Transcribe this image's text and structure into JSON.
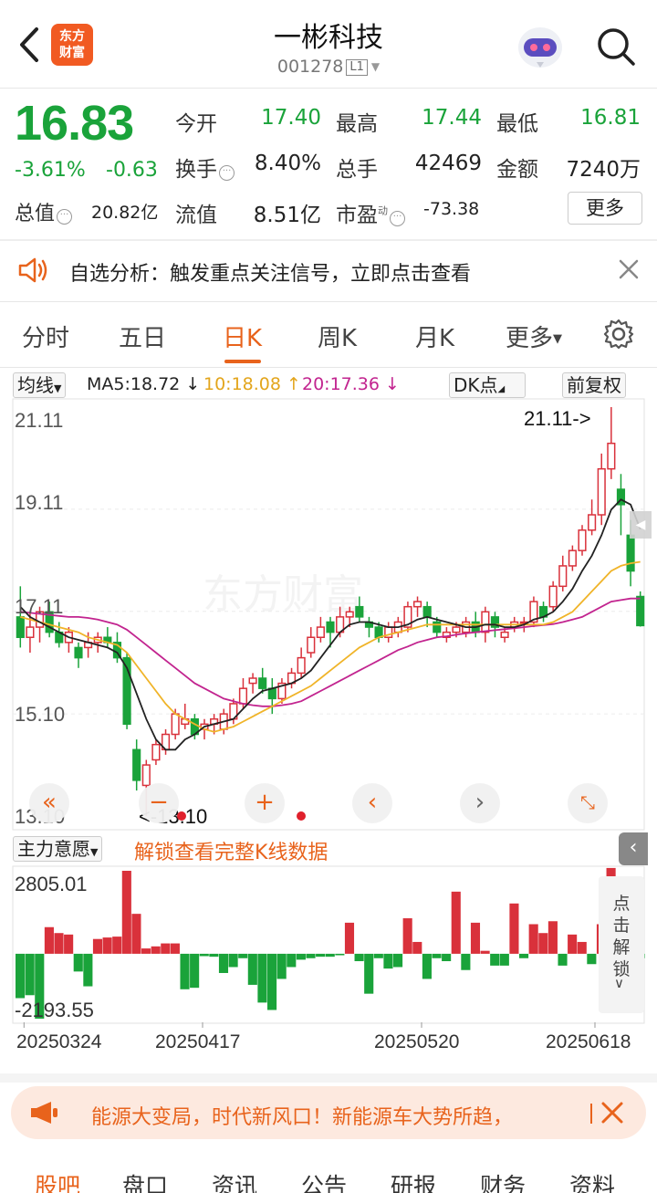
{
  "header": {
    "logo_line1": "东方",
    "logo_line2": "财富",
    "stock_name": "一彬科技",
    "stock_code": "001278",
    "market_tag": "L1"
  },
  "quote": {
    "price": "16.83",
    "change_pct": "-3.61%",
    "change": "-0.63",
    "open_label": "今开",
    "open": "17.40",
    "high_label": "最高",
    "high": "17.44",
    "low_label": "最低",
    "low": "16.81",
    "turnover_label": "换手",
    "turnover": "8.40%",
    "volume_label": "总手",
    "volume": "42469",
    "amount_label": "金额",
    "amount": "7240万",
    "total_value_label": "总值",
    "total_value": "20.82亿",
    "float_value_label": "流值",
    "float_value": "8.51亿",
    "pe_label": "市盈",
    "pe_sup": "动",
    "pe": "-73.38",
    "more_label": "更多"
  },
  "analysis_banner": {
    "text": "自选分析：触发重点关注信号，立即点击查看"
  },
  "tabs": [
    "分时",
    "五日",
    "日K",
    "周K",
    "月K",
    "更多"
  ],
  "active_tab": "日K",
  "chart_toolbar": {
    "ma_select": "均线",
    "ma5": "MA5:18.72 ↓",
    "ma10": "10:18.08 ↑",
    "ma20": "20:17.36 ↓",
    "dk_label": "DK点",
    "adjust_label": "前复权"
  },
  "colors": {
    "up": "#d9313b",
    "down": "#1aa33a",
    "ma5": "#222222",
    "ma10": "#f0b429",
    "ma20": "#c2248f",
    "accent": "#e8631c"
  },
  "price_axis": [
    "21.11",
    "19.11",
    "17.11",
    "15.10",
    "13.10"
  ],
  "annotations": {
    "max": "21.11->",
    "min": "<-13.10"
  },
  "indicator": {
    "select_label": "主力意愿",
    "unlock_text": "解锁查看完整K线数据",
    "max_label": "2805.01",
    "min_label": "-2193.55",
    "side_unlock": "点击解锁"
  },
  "dates": [
    "20250324",
    "20250417",
    "20250520",
    "20250618"
  ],
  "promo": {
    "text": "能源大变局，时代新风口！新能源车大势所趋，"
  },
  "bottom_nav": [
    "股吧",
    "盘口",
    "资讯",
    "公告",
    "研报",
    "财务",
    "资料"
  ],
  "chart_data": {
    "type": "candlestick",
    "y_range": [
      13.1,
      21.11
    ],
    "candles": [
      [
        17.0,
        17.6,
        16.4,
        16.6
      ],
      [
        16.6,
        17.1,
        16.3,
        16.8
      ],
      [
        16.8,
        17.2,
        16.5,
        17.1
      ],
      [
        17.1,
        17.3,
        16.6,
        16.7
      ],
      [
        16.7,
        16.9,
        16.4,
        16.5
      ],
      [
        16.5,
        16.8,
        16.3,
        16.7
      ],
      [
        16.4,
        16.5,
        16.0,
        16.2
      ],
      [
        16.4,
        16.7,
        16.2,
        16.5
      ],
      [
        16.5,
        16.7,
        16.3,
        16.6
      ],
      [
        16.6,
        16.8,
        16.4,
        16.5
      ],
      [
        16.5,
        16.7,
        16.1,
        16.2
      ],
      [
        16.2,
        16.3,
        14.8,
        14.9
      ],
      [
        14.4,
        14.6,
        13.6,
        13.8
      ],
      [
        13.7,
        14.2,
        13.1,
        14.1
      ],
      [
        14.2,
        14.6,
        14.1,
        14.5
      ],
      [
        14.4,
        14.8,
        14.3,
        14.7
      ],
      [
        14.7,
        15.2,
        14.6,
        15.1
      ],
      [
        14.9,
        15.3,
        14.8,
        15.0
      ],
      [
        15.0,
        15.1,
        14.6,
        14.7
      ],
      [
        14.8,
        15.0,
        14.6,
        14.9
      ],
      [
        14.9,
        15.1,
        14.7,
        15.0
      ],
      [
        14.8,
        15.2,
        14.7,
        15.1
      ],
      [
        15.0,
        15.4,
        14.9,
        15.3
      ],
      [
        15.3,
        15.8,
        15.2,
        15.6
      ],
      [
        15.7,
        15.9,
        15.5,
        15.8
      ],
      [
        15.8,
        16.0,
        15.5,
        15.6
      ],
      [
        15.6,
        15.8,
        15.1,
        15.4
      ],
      [
        15.4,
        15.8,
        15.3,
        15.7
      ],
      [
        15.7,
        16.0,
        15.6,
        15.9
      ],
      [
        15.9,
        16.4,
        15.8,
        16.2
      ],
      [
        16.3,
        16.8,
        16.2,
        16.6
      ],
      [
        16.6,
        17.0,
        16.5,
        16.8
      ],
      [
        16.9,
        17.0,
        16.4,
        16.7
      ],
      [
        16.7,
        17.2,
        16.6,
        17.0
      ],
      [
        17.0,
        17.2,
        16.8,
        17.1
      ],
      [
        17.2,
        17.4,
        16.9,
        17.0
      ],
      [
        16.9,
        17.0,
        16.6,
        16.8
      ],
      [
        16.8,
        16.9,
        16.5,
        16.6
      ],
      [
        16.6,
        16.9,
        16.5,
        16.8
      ],
      [
        16.7,
        17.0,
        16.6,
        16.9
      ],
      [
        16.8,
        17.3,
        16.7,
        17.2
      ],
      [
        17.2,
        17.4,
        17.0,
        17.3
      ],
      [
        17.2,
        17.3,
        16.8,
        17.0
      ],
      [
        16.9,
        17.0,
        16.6,
        16.7
      ],
      [
        16.6,
        16.8,
        16.5,
        16.7
      ],
      [
        16.7,
        16.9,
        16.6,
        16.8
      ],
      [
        16.7,
        17.0,
        16.6,
        16.9
      ],
      [
        16.9,
        17.1,
        16.6,
        16.7
      ],
      [
        16.7,
        17.2,
        16.5,
        17.1
      ],
      [
        17.0,
        17.1,
        16.6,
        16.8
      ],
      [
        16.6,
        16.8,
        16.5,
        16.7
      ],
      [
        16.8,
        17.0,
        16.7,
        16.9
      ],
      [
        16.9,
        17.0,
        16.7,
        16.9
      ],
      [
        16.9,
        17.4,
        16.8,
        17.3
      ],
      [
        17.2,
        17.3,
        16.9,
        17.0
      ],
      [
        17.2,
        17.7,
        17.1,
        17.6
      ],
      [
        17.6,
        18.2,
        17.5,
        18.0
      ],
      [
        18.0,
        18.4,
        17.9,
        18.3
      ],
      [
        18.3,
        18.8,
        18.2,
        18.7
      ],
      [
        18.7,
        19.3,
        18.6,
        19.0
      ],
      [
        19.0,
        20.2,
        18.8,
        19.9
      ],
      [
        19.9,
        21.11,
        19.7,
        20.4
      ],
      [
        19.5,
        19.8,
        18.6,
        19.2
      ],
      [
        18.6,
        18.9,
        17.6,
        17.9
      ],
      [
        17.4,
        17.5,
        16.81,
        16.83
      ]
    ],
    "ma5": [
      17.2,
      17.0,
      16.9,
      16.8,
      16.7,
      16.6,
      16.55,
      16.5,
      16.45,
      16.4,
      16.3,
      16.0,
      15.5,
      15.0,
      14.6,
      14.4,
      14.4,
      14.6,
      14.7,
      14.85,
      14.9,
      14.95,
      15.0,
      15.2,
      15.4,
      15.55,
      15.6,
      15.65,
      15.7,
      15.8,
      15.95,
      16.2,
      16.45,
      16.7,
      16.85,
      16.9,
      16.9,
      16.85,
      16.8,
      16.8,
      16.85,
      16.95,
      17.0,
      16.95,
      16.9,
      16.85,
      16.8,
      16.8,
      16.85,
      16.85,
      16.8,
      16.8,
      16.85,
      16.95,
      17.0,
      17.1,
      17.3,
      17.55,
      17.9,
      18.2,
      18.6,
      19.1,
      19.3,
      19.2,
      18.72
    ],
    "ma10": [
      17.0,
      16.95,
      16.9,
      16.85,
      16.8,
      16.75,
      16.7,
      16.6,
      16.55,
      16.5,
      16.45,
      16.3,
      16.05,
      15.8,
      15.55,
      15.3,
      15.1,
      15.0,
      14.9,
      14.8,
      14.75,
      14.8,
      14.85,
      14.95,
      15.05,
      15.15,
      15.25,
      15.35,
      15.45,
      15.55,
      15.65,
      15.8,
      15.95,
      16.1,
      16.25,
      16.4,
      16.5,
      16.6,
      16.65,
      16.7,
      16.75,
      16.8,
      16.85,
      16.85,
      16.85,
      16.85,
      16.85,
      16.85,
      16.85,
      16.85,
      16.85,
      16.85,
      16.85,
      16.85,
      16.85,
      16.9,
      17.0,
      17.1,
      17.3,
      17.5,
      17.7,
      17.9,
      18.0,
      18.05,
      18.08
    ],
    "ma20": [
      17.1,
      17.08,
      17.06,
      17.04,
      17.02,
      17.0,
      17.0,
      16.98,
      16.95,
      16.9,
      16.85,
      16.75,
      16.6,
      16.45,
      16.3,
      16.15,
      16.0,
      15.85,
      15.7,
      15.6,
      15.5,
      15.4,
      15.35,
      15.3,
      15.27,
      15.25,
      15.25,
      15.27,
      15.3,
      15.35,
      15.45,
      15.55,
      15.65,
      15.75,
      15.85,
      15.95,
      16.05,
      16.15,
      16.25,
      16.35,
      16.42,
      16.5,
      16.55,
      16.6,
      16.62,
      16.65,
      16.68,
      16.7,
      16.72,
      16.74,
      16.76,
      16.78,
      16.8,
      16.82,
      16.84,
      16.86,
      16.9,
      16.95,
      17.0,
      17.1,
      17.2,
      17.3,
      17.33,
      17.36,
      17.36
    ]
  }
}
